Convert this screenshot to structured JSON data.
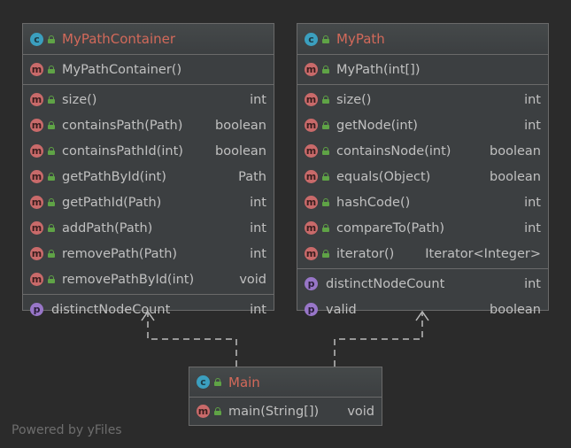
{
  "classes": {
    "container": {
      "name": "MyPathContainer",
      "constructor": "MyPathContainer()",
      "methods": [
        {
          "name": "size()",
          "type": "int"
        },
        {
          "name": "containsPath(Path)",
          "type": "boolean"
        },
        {
          "name": "containsPathId(int)",
          "type": "boolean"
        },
        {
          "name": "getPathById(int)",
          "type": "Path"
        },
        {
          "name": "getPathId(Path)",
          "type": "int"
        },
        {
          "name": "addPath(Path)",
          "type": "int"
        },
        {
          "name": "removePath(Path)",
          "type": "int"
        },
        {
          "name": "removePathById(int)",
          "type": "void"
        }
      ],
      "properties": [
        {
          "name": "distinctNodeCount",
          "type": "int"
        }
      ]
    },
    "path": {
      "name": "MyPath",
      "constructor": "MyPath(int[])",
      "methods": [
        {
          "name": "size()",
          "type": "int"
        },
        {
          "name": "getNode(int)",
          "type": "int"
        },
        {
          "name": "containsNode(int)",
          "type": "boolean"
        },
        {
          "name": "equals(Object)",
          "type": "boolean"
        },
        {
          "name": "hashCode()",
          "type": "int"
        },
        {
          "name": "compareTo(Path)",
          "type": "int"
        },
        {
          "name": "iterator()",
          "type": "Iterator<Integer>"
        }
      ],
      "properties": [
        {
          "name": "distinctNodeCount",
          "type": "int"
        },
        {
          "name": "valid",
          "type": "boolean"
        }
      ]
    },
    "main": {
      "name": "Main",
      "methods": [
        {
          "name": "main(String[])",
          "type": "void"
        }
      ]
    }
  },
  "badges": {
    "class": "c",
    "method": "m",
    "property": "p"
  },
  "watermark": "Powered by yFiles",
  "colors": {
    "background": "#2b2b2b",
    "node": "#3c3f41",
    "class_name": "#d2695a",
    "edge": "#bbbbbb"
  }
}
